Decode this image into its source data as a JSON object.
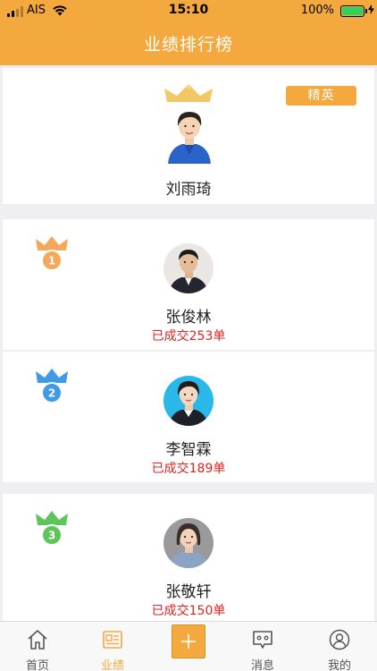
{
  "status_bar": {
    "carrier": "AIS",
    "time": "15:10",
    "battery": "100%"
  },
  "nav": {
    "title": "业绩排行榜"
  },
  "champion": {
    "name": "刘雨琦",
    "badge": "精英"
  },
  "rankings": [
    {
      "rank": "1",
      "name": "张俊林",
      "deals": "已成交253单",
      "medal_color": "#f3a85a"
    },
    {
      "rank": "2",
      "name": "李智霖",
      "deals": "已成交189单",
      "medal_color": "#3f9be6"
    },
    {
      "rank": "3",
      "name": "张敬轩",
      "deals": "已成交150单",
      "medal_color": "#5ec55b"
    }
  ],
  "tabbar": {
    "home": "首页",
    "performance": "业绩",
    "messages": "消息",
    "mine": "我的"
  },
  "colors": {
    "brand": "#f4a93e",
    "deal_text": "#e0231f"
  },
  "icons": {
    "home": "home-icon",
    "performance": "id-card-icon",
    "add": "plus-icon",
    "messages": "chat-bubble-icon",
    "mine": "user-circle-icon"
  }
}
